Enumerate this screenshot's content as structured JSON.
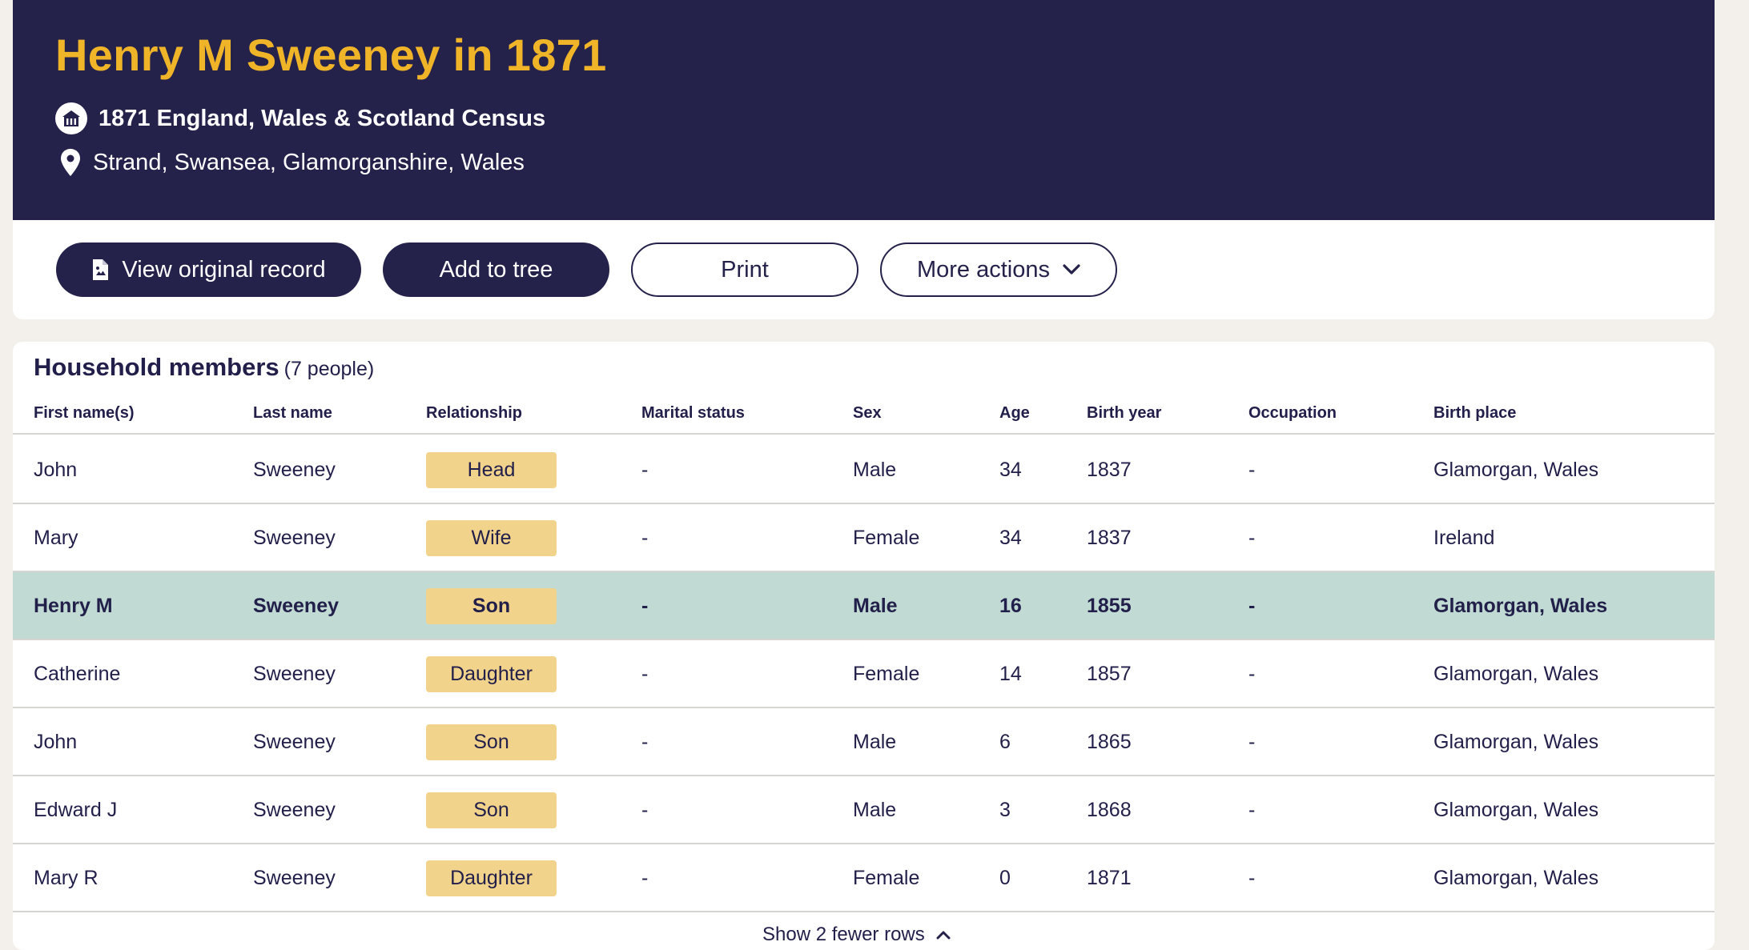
{
  "hero": {
    "title": "Henry M Sweeney in 1871",
    "collection": "1871 England, Wales & Scotland Census",
    "location": "Strand, Swansea, Glamorganshire, Wales"
  },
  "actions": {
    "view_original": "View original record",
    "add_to_tree": "Add to tree",
    "print": "Print",
    "more_actions": "More actions"
  },
  "household": {
    "title": "Household members",
    "count": "(7 people)",
    "columns": [
      "First name(s)",
      "Last name",
      "Relationship",
      "Marital status",
      "Sex",
      "Age",
      "Birth year",
      "Occupation",
      "Birth place"
    ],
    "rows": [
      {
        "first": "John",
        "last": "Sweeney",
        "relationship": "Head",
        "marital": "-",
        "sex": "Male",
        "age": "34",
        "birth_year": "1837",
        "occupation": "-",
        "birth_place": "Glamorgan, Wales"
      },
      {
        "first": "Mary",
        "last": "Sweeney",
        "relationship": "Wife",
        "marital": "-",
        "sex": "Female",
        "age": "34",
        "birth_year": "1837",
        "occupation": "-",
        "birth_place": "Ireland"
      },
      {
        "first": "Henry M",
        "last": "Sweeney",
        "relationship": "Son",
        "marital": "-",
        "sex": "Male",
        "age": "16",
        "birth_year": "1855",
        "occupation": "-",
        "birth_place": "Glamorgan, Wales"
      },
      {
        "first": "Catherine",
        "last": "Sweeney",
        "relationship": "Daughter",
        "marital": "-",
        "sex": "Female",
        "age": "14",
        "birth_year": "1857",
        "occupation": "-",
        "birth_place": "Glamorgan, Wales"
      },
      {
        "first": "John",
        "last": "Sweeney",
        "relationship": "Son",
        "marital": "-",
        "sex": "Male",
        "age": "6",
        "birth_year": "1865",
        "occupation": "-",
        "birth_place": "Glamorgan, Wales"
      },
      {
        "first": "Edward J",
        "last": "Sweeney",
        "relationship": "Son",
        "marital": "-",
        "sex": "Male",
        "age": "3",
        "birth_year": "1868",
        "occupation": "-",
        "birth_place": "Glamorgan, Wales"
      },
      {
        "first": "Mary R",
        "last": "Sweeney",
        "relationship": "Daughter",
        "marital": "-",
        "sex": "Female",
        "age": "0",
        "birth_year": "1871",
        "occupation": "-",
        "birth_place": "Glamorgan, Wales"
      }
    ],
    "show_rows": "Show 2 fewer rows"
  },
  "colors": {
    "navy": "#24214a",
    "gold": "#f0b429",
    "badge": "#f2d38c",
    "highlight_row": "#c1dbd4"
  },
  "icons": [
    "house-icon",
    "location-pin-icon",
    "document-icon",
    "chevron-down-icon",
    "chevron-up-icon"
  ]
}
